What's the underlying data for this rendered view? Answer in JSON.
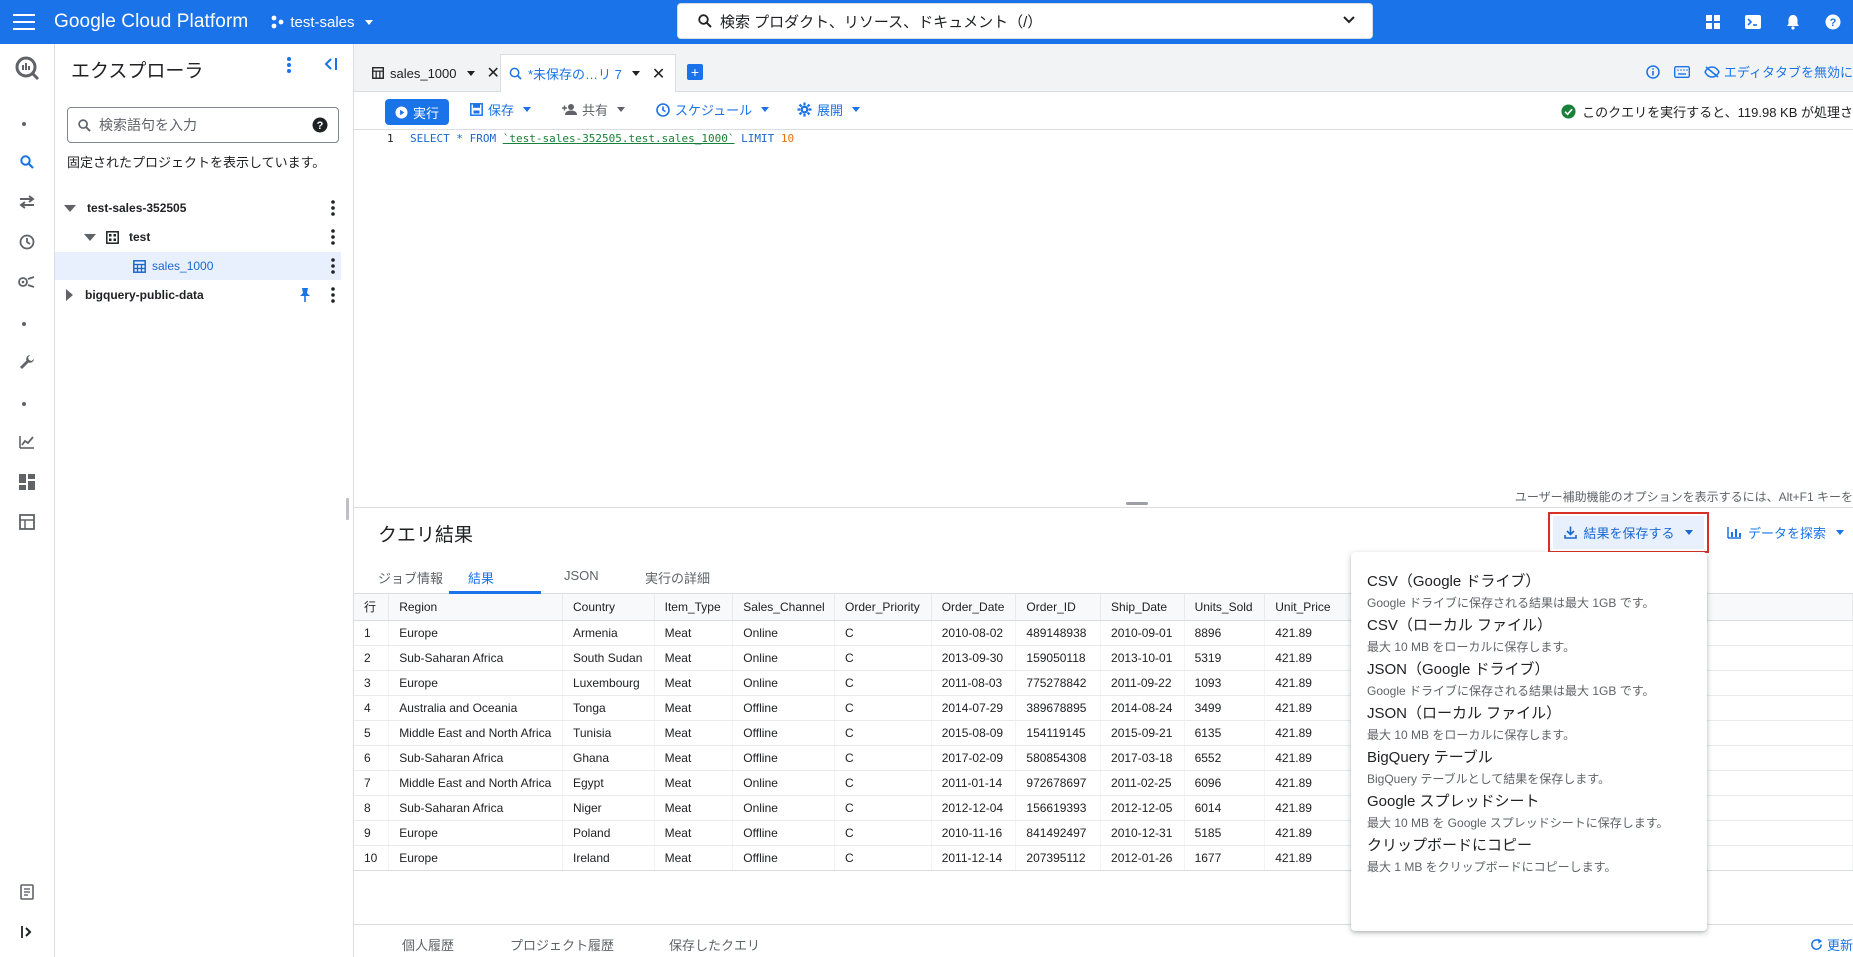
{
  "topbar": {
    "brand": "Google Cloud Platform",
    "project": "test-sales",
    "search_label": "検索 プロダクト、リソース、ドキュメント（/）"
  },
  "explorer": {
    "title": "エクスプローラ",
    "search_placeholder": "検索語句を入力",
    "note": "固定されたプロジェクトを表示しています。",
    "tree": {
      "project": "test-sales-352505",
      "dataset": "test",
      "table": "sales_1000",
      "public": "bigquery-public-data"
    }
  },
  "tabs": {
    "tab1": "sales_1000",
    "tab2": "*未保存の…リ 7",
    "editor_tab_label": "エディタタブを無効に"
  },
  "toolbar": {
    "run": "実行",
    "save": "保存",
    "share": "共有",
    "schedule": "スケジュール",
    "deploy": "展開",
    "validator": "このクエリを実行すると、119.98 KB が処理さ"
  },
  "editor": {
    "line_no": "1",
    "kw1": "SELECT * FROM ",
    "table_ref": "`test-sales-352505.test.sales_1000`",
    "kw2": " LIMIT ",
    "limit": "10",
    "a11y_hint": "ユーザー補助機能のオプションを表示するには、Alt+F1 キーを"
  },
  "results": {
    "title": "クエリ結果",
    "save_results": "結果を保存する",
    "explore_data": "データを探索",
    "tabs": [
      "ジョブ情報",
      "結果",
      "JSON",
      "実行の詳細"
    ],
    "columns": [
      "行",
      "Region",
      "Country",
      "Item_Type",
      "Sales_Channel",
      "Order_Priority",
      "Order_Date",
      "Order_ID",
      "Ship_Date",
      "Units_Sold",
      "Unit_Price"
    ],
    "rows": [
      [
        "1",
        "Europe",
        "Armenia",
        "Meat",
        "Online",
        "C",
        "2010-08-02",
        "489148938",
        "2010-09-01",
        "8896",
        "421.89"
      ],
      [
        "2",
        "Sub-Saharan Africa",
        "South Sudan",
        "Meat",
        "Online",
        "C",
        "2013-09-30",
        "159050118",
        "2013-10-01",
        "5319",
        "421.89"
      ],
      [
        "3",
        "Europe",
        "Luxembourg",
        "Meat",
        "Online",
        "C",
        "2011-08-03",
        "775278842",
        "2011-09-22",
        "1093",
        "421.89"
      ],
      [
        "4",
        "Australia and Oceania",
        "Tonga",
        "Meat",
        "Offline",
        "C",
        "2014-07-29",
        "389678895",
        "2014-08-24",
        "3499",
        "421.89"
      ],
      [
        "5",
        "Middle East and North Africa",
        "Tunisia",
        "Meat",
        "Offline",
        "C",
        "2015-08-09",
        "154119145",
        "2015-09-21",
        "6135",
        "421.89"
      ],
      [
        "6",
        "Sub-Saharan Africa",
        "Ghana",
        "Meat",
        "Offline",
        "C",
        "2017-02-09",
        "580854308",
        "2017-03-18",
        "6552",
        "421.89"
      ],
      [
        "7",
        "Middle East and North Africa",
        "Egypt",
        "Meat",
        "Online",
        "C",
        "2011-01-14",
        "972678697",
        "2011-02-25",
        "6096",
        "421.89"
      ],
      [
        "8",
        "Sub-Saharan Africa",
        "Niger",
        "Meat",
        "Online",
        "C",
        "2012-12-04",
        "156619393",
        "2012-12-05",
        "6014",
        "421.89"
      ],
      [
        "9",
        "Europe",
        "Poland",
        "Meat",
        "Offline",
        "C",
        "2010-11-16",
        "841492497",
        "2010-12-31",
        "5185",
        "421.89"
      ],
      [
        "10",
        "Europe",
        "Ireland",
        "Meat",
        "Offline",
        "C",
        "2011-12-14",
        "207395112",
        "2012-01-26",
        "1677",
        "421.89"
      ]
    ]
  },
  "save_menu": [
    {
      "title": "CSV（Google ドライブ）",
      "desc": "Google ドライブに保存される結果は最大 1GB です。"
    },
    {
      "title": "CSV（ローカル ファイル）",
      "desc": "最大 10 MB をローカルに保存します。"
    },
    {
      "title": "JSON（Google ドライブ）",
      "desc": "Google ドライブに保存される結果は最大 1GB です。"
    },
    {
      "title": "JSON（ローカル ファイル）",
      "desc": "最大 10 MB をローカルに保存します。"
    },
    {
      "title": "BigQuery テーブル",
      "desc": "BigQuery テーブルとして結果を保存します。"
    },
    {
      "title": "Google スプレッドシート",
      "desc": "最大 10 MB を Google スプレッドシートに保存します。"
    },
    {
      "title": "クリップボードにコピー",
      "desc": "最大 1 MB をクリップボードにコピーします。"
    }
  ],
  "history": {
    "personal": "個人履歴",
    "project": "プロジェクト履歴",
    "saved": "保存したクエリ",
    "refresh": "更新"
  },
  "colors": {
    "brand_blue": "#1a73e8",
    "highlight_red": "#d93025",
    "success_green": "#188038"
  }
}
